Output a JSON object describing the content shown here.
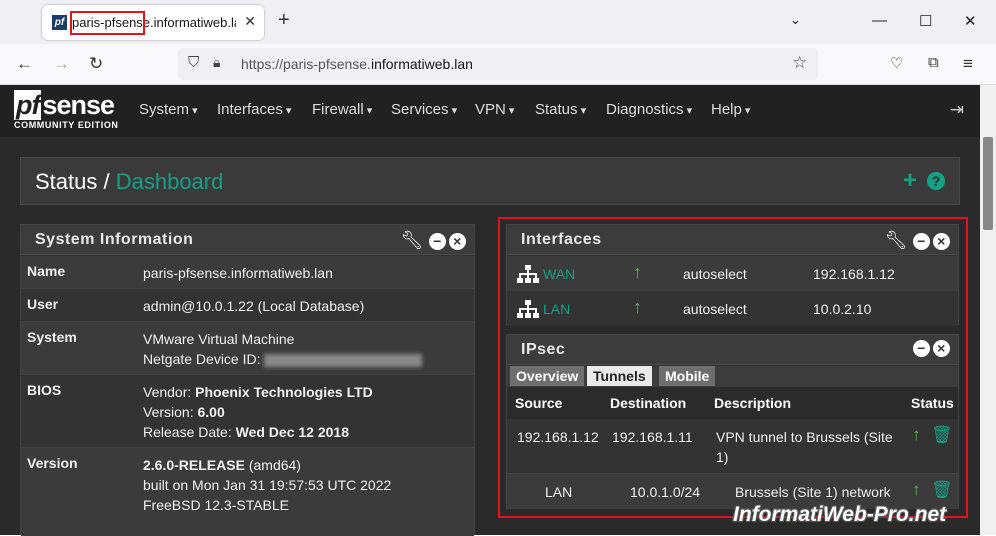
{
  "browser": {
    "tab_title": "paris-pfsense.informatiweb.lan",
    "favicon_text": "pf",
    "url_prefix": "https://paris-pfsense.",
    "url_domain": "informatiweb.lan",
    "new_tab": "+"
  },
  "pfsense": {
    "logo_main": "sense",
    "logo_pf": "pf",
    "logo_edition": "COMMUNITY EDITION",
    "menu": [
      "System",
      "Interfaces",
      "Firewall",
      "Services",
      "VPN",
      "Status",
      "Diagnostics",
      "Help"
    ]
  },
  "breadcrumb": {
    "section": "Status /",
    "page": "Dashboard"
  },
  "system_info": {
    "title": "System Information",
    "name_label": "Name",
    "name_value": "paris-pfsense.informatiweb.lan",
    "user_label": "User",
    "user_value": "admin@10.0.1.22 (Local Database)",
    "system_label": "System",
    "system_line1": "VMware Virtual Machine",
    "system_line2": "Netgate Device ID:",
    "bios_label": "BIOS",
    "bios_vendor_prefix": "Vendor: ",
    "bios_vendor": "Phoenix Technologies LTD",
    "bios_version_prefix": "Version: ",
    "bios_version": "6.00",
    "bios_date_prefix": "Release Date: ",
    "bios_date": "Wed Dec 12 2018",
    "version_label": "Version",
    "version_main": "2.6.0-RELEASE",
    "version_arch": " (amd64)",
    "version_built": "built on Mon Jan 31 19:57:53 UTC 2022",
    "version_os": "FreeBSD 12.3-STABLE"
  },
  "interfaces": {
    "title": "Interfaces",
    "rows": [
      {
        "name": "WAN",
        "media": "autoselect",
        "ip": "192.168.1.12"
      },
      {
        "name": "LAN",
        "media": "autoselect",
        "ip": "10.0.2.10"
      }
    ]
  },
  "ipsec": {
    "title": "IPsec",
    "tabs": [
      "Overview",
      "Tunnels",
      "Mobile"
    ],
    "active_tab": "Tunnels",
    "headers": {
      "source": "Source",
      "destination": "Destination",
      "description": "Description",
      "status": "Status"
    },
    "tunnel": {
      "source": "192.168.1.12",
      "destination": "192.168.1.11",
      "description": "VPN tunnel to Brussels (Site 1)"
    },
    "phase2": {
      "source": "LAN",
      "destination": "10.0.1.0/24",
      "description": "Brussels (Site 1) network"
    }
  },
  "watermark": "InformatiWeb-Pro.net",
  "colors": {
    "accent": "#16a086",
    "status_up": "#5cb85c",
    "highlight": "#e0141a",
    "navbar": "#212121"
  }
}
